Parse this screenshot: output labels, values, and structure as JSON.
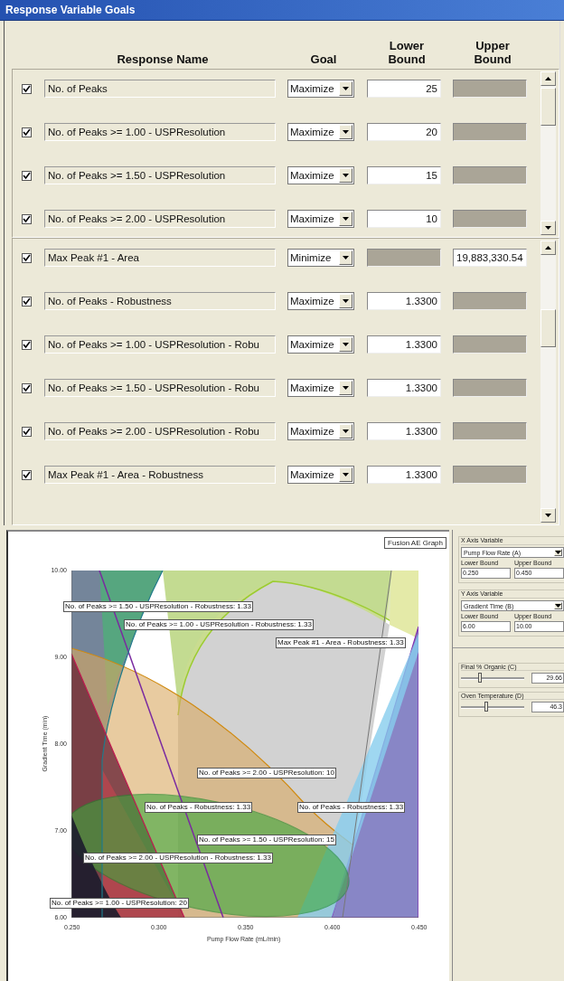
{
  "window": {
    "title": "Response Variable Goals"
  },
  "columns": [
    "Response Name",
    "Goal",
    "Lower Bound",
    "Upper Bound"
  ],
  "groups": [
    {
      "rows": [
        {
          "checked": true,
          "name": "No. of Peaks",
          "goal": "Maximize",
          "lower": {
            "disabled": false,
            "value": "25"
          },
          "upper": {
            "disabled": true
          }
        },
        {
          "checked": true,
          "name": "No. of Peaks >= 1.00 - USPResolution",
          "goal": "Maximize",
          "lower": {
            "disabled": false,
            "value": "20"
          },
          "upper": {
            "disabled": true
          }
        },
        {
          "checked": true,
          "name": "No. of Peaks >= 1.50 - USPResolution",
          "goal": "Maximize",
          "lower": {
            "disabled": false,
            "value": "15"
          },
          "upper": {
            "disabled": true
          }
        },
        {
          "checked": true,
          "name": "No. of Peaks >= 2.00 - USPResolution",
          "goal": "Maximize",
          "lower": {
            "disabled": false,
            "value": "10"
          },
          "upper": {
            "disabled": true
          }
        }
      ]
    },
    {
      "rows": [
        {
          "checked": true,
          "name": "Max Peak #1 - Area",
          "goal": "Minimize",
          "lower": {
            "disabled": true
          },
          "upper": {
            "disabled": false,
            "value": "19,883,330.54"
          }
        },
        {
          "checked": true,
          "name": "No. of Peaks - Robustness",
          "goal": "Maximize",
          "lower": {
            "disabled": false,
            "value": "1.3300"
          },
          "upper": {
            "disabled": true
          }
        },
        {
          "checked": true,
          "name": "No. of Peaks >= 1.00 - USPResolution - Robu",
          "goal": "Maximize",
          "lower": {
            "disabled": false,
            "value": "1.3300"
          },
          "upper": {
            "disabled": true
          }
        },
        {
          "checked": true,
          "name": "No. of Peaks >= 1.50 - USPResolution - Robu",
          "goal": "Maximize",
          "lower": {
            "disabled": false,
            "value": "1.3300"
          },
          "upper": {
            "disabled": true
          }
        },
        {
          "checked": true,
          "name": "No. of Peaks >= 2.00 - USPResolution - Robu",
          "goal": "Maximize",
          "lower": {
            "disabled": false,
            "value": "1.3300"
          },
          "upper": {
            "disabled": true
          }
        },
        {
          "checked": true,
          "name": "Max Peak #1 - Area - Robustness",
          "goal": "Maximize",
          "lower": {
            "disabled": false,
            "value": "1.3300"
          },
          "upper": {
            "disabled": true
          }
        }
      ]
    }
  ],
  "graph": {
    "button": "Fusion AE Graph",
    "xlabel": "Pump Flow Rate (mL/min)",
    "ylabel": "Gradient Time (min)",
    "xticks": [
      "0.250",
      "0.300",
      "0.350",
      "0.400",
      "0.450"
    ],
    "yticks": [
      "10.00",
      "9.00",
      "8.00",
      "7.00",
      "6.00"
    ],
    "labels": [
      "No. of Peaks >= 1.50 - USPResolution - Robustness: 1.33",
      "No. of Peaks >= 1.00 - USPResolution - Robustness: 1.33",
      "Max Peak #1 - Area - Robustness: 1.33",
      "No. of Peaks >= 2.00 - USPResolution: 10",
      "No. of Peaks - Robustness: 1.33",
      "No. of Peaks - Robustness: 1.33",
      "No. of Peaks >= 1.50 - USPResolution: 15",
      "No. of Peaks >= 2.00 - USPResolution - Robustness: 1.33",
      "No. of Peaks >= 1.00 - USPResolution: 20"
    ]
  },
  "axes": [
    {
      "title": "X Axis Variable",
      "variable": "Pump Flow Rate (A)",
      "lower_label": "Lower Bound",
      "upper_label": "Upper Bound",
      "lower": "0.250",
      "upper": "0.450"
    },
    {
      "title": "Y Axis Variable",
      "variable": "Gradient Time (B)",
      "lower_label": "Lower Bound",
      "upper_label": "Upper Bound",
      "lower": "6.00",
      "upper": "10.00"
    }
  ],
  "factors": [
    {
      "label": "Final % Organic (C)",
      "level": 0.3,
      "value": "29.66"
    },
    {
      "label": "Oven Temperature (D)",
      "level": 0.4,
      "value": "46.3"
    }
  ]
}
